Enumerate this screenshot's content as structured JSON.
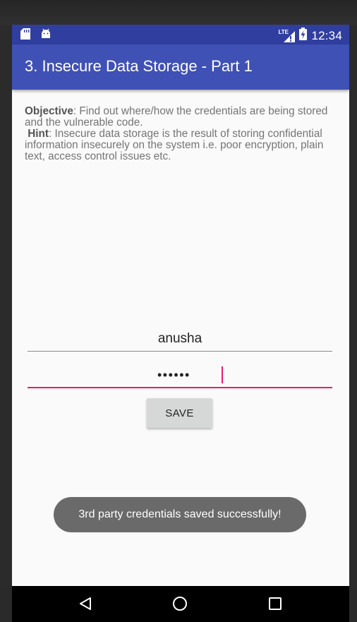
{
  "status_bar": {
    "time": "12:34",
    "network_label": "LTE",
    "icons": [
      "sd-card-icon",
      "android-debug-icon",
      "lte-signal-icon",
      "battery-charging-icon"
    ]
  },
  "app_bar": {
    "title": "3. Insecure Data Storage - Part 1"
  },
  "description": {
    "objective_label": "Objective",
    "objective_text": ": Find out where/how the credentials are being stored and the vulnerable code.",
    "hint_label": "Hint",
    "hint_text": ": Insecure data storage is the result of storing confidential information insecurely on the system i.e. poor encryption, plain text, access control issues etc."
  },
  "form": {
    "username_value": "anusha",
    "password_masked": "••••••",
    "save_label": "SAVE"
  },
  "toast": {
    "message": "3rd party credentials saved successfully!"
  },
  "nav_bar": {
    "buttons": [
      "back-icon",
      "home-icon",
      "recents-icon"
    ]
  },
  "colors": {
    "status_bar": "#303f9f",
    "app_bar": "#3f51b5",
    "accent": "#e91e63",
    "toast": "#6a6a6a"
  }
}
